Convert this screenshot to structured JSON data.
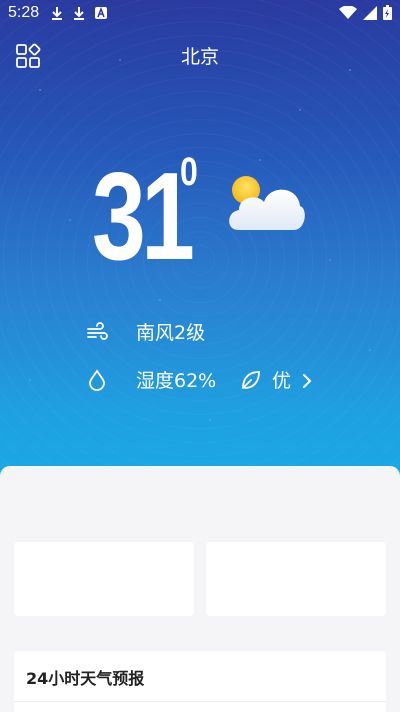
{
  "status_bar": {
    "time": "5:28",
    "icons": [
      "download-icon",
      "download-icon",
      "app-a-icon",
      "wifi-icon",
      "signal-icon",
      "battery-icon"
    ]
  },
  "header": {
    "city": "北京"
  },
  "current": {
    "temperature": "31",
    "degree_symbol": "0",
    "condition_icon": "partly-cloudy-icon",
    "wind": "南风2级",
    "humidity": "湿度62%",
    "air_quality": "优"
  },
  "forecast": {
    "title": "24小时天气预报"
  },
  "colors": {
    "gradient_top": "#2a3aa0",
    "gradient_bottom": "#1aa8e6",
    "sheet": "#f5f5f7",
    "sun": "#f5c20f"
  }
}
